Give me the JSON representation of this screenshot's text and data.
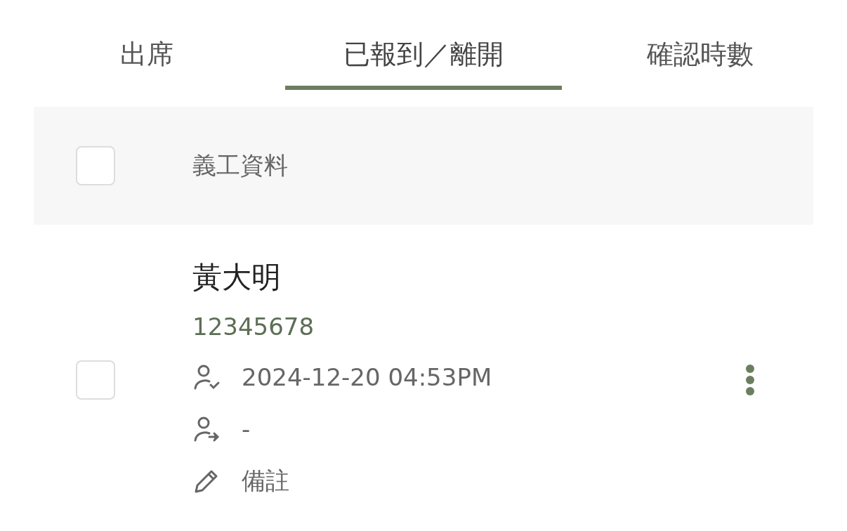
{
  "tabs": [
    {
      "label": "出席",
      "selected": false
    },
    {
      "label": "已報到／離開",
      "selected": true
    },
    {
      "label": "確認時數",
      "selected": false
    }
  ],
  "header": {
    "checked": false,
    "label": "義工資料"
  },
  "volunteers": [
    {
      "checked": false,
      "name": "黃大明",
      "id": "12345678",
      "details": [
        {
          "kind": "check_in",
          "text": "2024-12-20 04:53PM"
        },
        {
          "kind": "check_out",
          "text": "-"
        },
        {
          "kind": "note",
          "text": "備註"
        }
      ]
    }
  ]
}
